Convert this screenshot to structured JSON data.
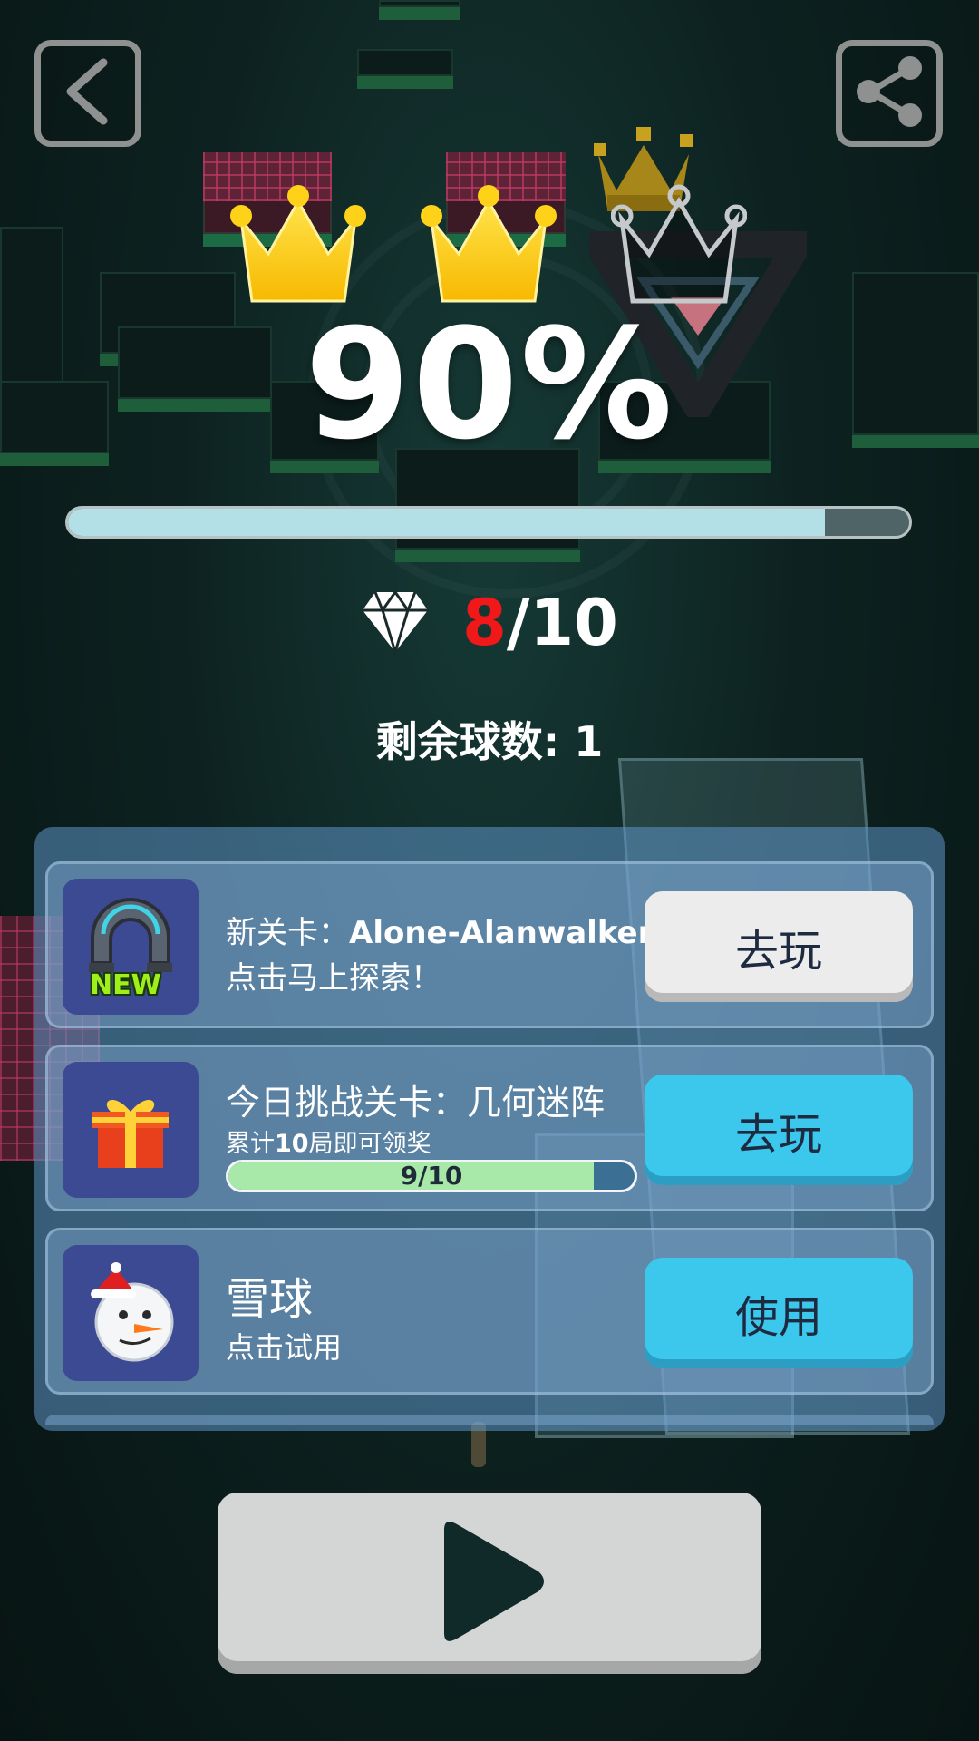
{
  "header": {
    "back_icon": "chevron-left-icon",
    "share_icon": "share-icon"
  },
  "result": {
    "crowns_earned": 2,
    "crowns_total": 3,
    "percent_text": "90%",
    "progress": 0.9,
    "gems": {
      "icon": "diamond-icon",
      "current": "8",
      "total": "/10"
    },
    "balls_left_text": "剩余球数: 1"
  },
  "rewards": [
    {
      "icon": "new-level-icon",
      "icon_badge": "NEW",
      "title_prefix": "新关卡：",
      "title_bold": "Alone-Alanwalker",
      "subtitle": "点击马上探索！",
      "button_label": "去玩",
      "button_style": "gray"
    },
    {
      "icon": "gift-icon",
      "title": "今日挑战关卡：几何迷阵",
      "subtitle_prefix": "累计",
      "subtitle_bold": "10",
      "subtitle_suffix": "局即可领奖",
      "progress_text": "9/10",
      "progress": 0.9,
      "button_label": "去玩",
      "button_style": "blue"
    },
    {
      "icon": "snowman-icon",
      "title": "雪球",
      "subtitle": "点击试用",
      "button_label": "使用",
      "button_style": "blue"
    }
  ],
  "play": {
    "icon": "play-icon"
  },
  "colors": {
    "crown_gold": "#ffd21a",
    "gem_highlight": "#f01818",
    "button_blue": "#3cc7ec",
    "panel_blue": "#5f96c8",
    "progress_fill": "#b3dfe6",
    "mini_progress_fill": "#a8e8a8"
  }
}
